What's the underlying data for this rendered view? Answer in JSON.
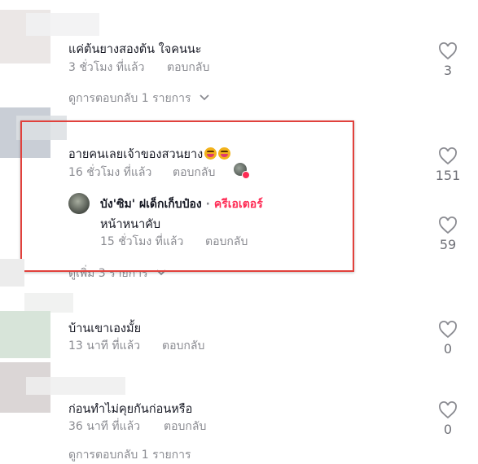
{
  "comments": [
    {
      "text": "แค่ต้นยางสองต้น ใจคนนะ",
      "time": "3 ชั่วโมง ที่แล้ว",
      "reply_label": "ตอบกลับ",
      "likes": "3",
      "view_replies": "ดูการตอบกลับ 1 รายการ",
      "avatar_color": "#e6e2e2"
    },
    {
      "text": "อายคนเลยเจ้าของสวนยาง",
      "time": "16 ชั่วโมง ที่แล้ว",
      "reply_label": "ตอบกลับ",
      "likes": "151",
      "avatar_color": "#c9ced6",
      "emojis": [
        "grin-icon",
        "grin-icon"
      ],
      "reply": {
        "author": "บัง'ซิม' ฝเด็กเก็บป๋อง",
        "separator": "·",
        "creator_tag": "ครีเอเตอร์",
        "text": "หน้าหนาคับ",
        "time": "15 ชั่วโมง ที่แล้ว",
        "reply_label": "ตอบกลับ",
        "likes": "59"
      },
      "view_more": "ดูเพิ่ม 3 รายการ"
    },
    {
      "text": "บ้านเขาเองมั้ย",
      "time": "13 นาที ที่แล้ว",
      "reply_label": "ตอบกลับ",
      "likes": "0",
      "avatar_color": "#d3e2d6"
    },
    {
      "text": "ก่อนทำไม่คุยกันก่อนหรือ",
      "time": "36 นาที ที่แล้ว",
      "reply_label": "ตอบกลับ",
      "likes": "0",
      "avatar_color": "#d9d4d4",
      "view_replies": "ดูการตอบกลับ 1 รายการ"
    }
  ],
  "colors": {
    "highlight": "#e1413c",
    "creator": "#fe2c55",
    "muted": "#8a8b91"
  }
}
